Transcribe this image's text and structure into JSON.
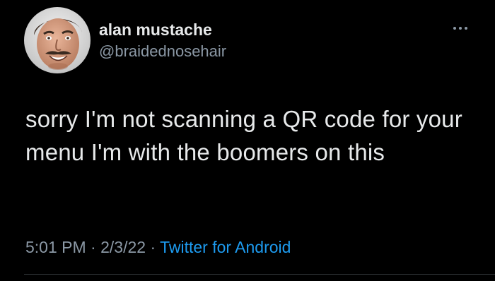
{
  "author": {
    "display_name": "alan mustache",
    "handle": "@braidednosehair",
    "avatar_icon": "profile-photo"
  },
  "tweet": {
    "text": "sorry I'm not scanning a QR code for your menu I'm with the boomers on this"
  },
  "meta": {
    "time": "5:01 PM",
    "separator_1": " · ",
    "date": "2/3/22",
    "separator_2": " · ",
    "source": "Twitter for Android"
  },
  "controls": {
    "more_icon": "more-horizontal-icon"
  },
  "colors": {
    "background": "#000000",
    "primary_text": "#e7e9ea",
    "secondary_text": "#8b98a5",
    "link": "#1d9bf0",
    "divider": "#2f3336"
  }
}
